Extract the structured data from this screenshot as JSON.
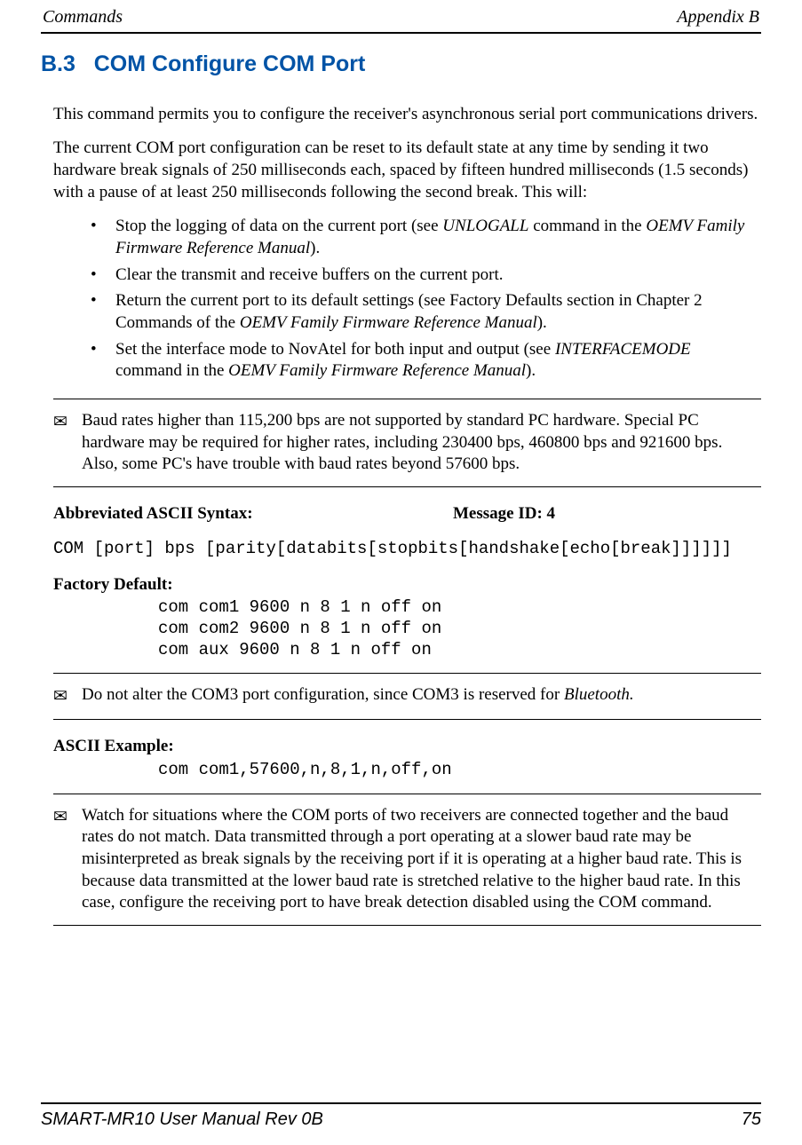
{
  "header": {
    "left": "Commands",
    "right": "Appendix B"
  },
  "section": {
    "number": "B.3",
    "title": "COM Configure COM Port"
  },
  "paragraphs": {
    "intro1": "This command permits you to configure the receiver's asynchronous serial port communications drivers.",
    "intro2": "The current COM port configuration can be reset to its default state at any time by sending it two hardware break signals of 250 milliseconds each, spaced by fifteen hundred milliseconds (1.5 seconds) with a pause of at least 250 milliseconds following the second break. This will:"
  },
  "bullets": {
    "b1a": "Stop the logging of data on the current port (see ",
    "b1b": "UNLOGALL",
    "b1c": " command in the ",
    "b1d": "OEMV Family Firmware Reference Manual",
    "b1e": ").",
    "b2": "Clear the transmit and receive buffers on the current port.",
    "b3a": "Return the current port to its default settings (see Factory Defaults section in Chapter 2 Commands of the ",
    "b3b": "OEMV Family Firmware Reference Manual",
    "b3c": ").",
    "b4a": "Set the interface mode to NovAtel for both input and output (see ",
    "b4b": "INTERFACEMODE",
    "b4c": " command in the ",
    "b4d": "OEMV Family Firmware Reference Manual",
    "b4e": ")."
  },
  "notes": {
    "n1": "Baud rates higher than 115,200 bps are not supported by standard PC hardware. Special PC hardware may be required for higher rates, including 230400 bps, 460800 bps and 921600 bps. Also, some PC's have trouble with baud rates beyond 57600 bps.",
    "n2a": "Do not alter the COM3 port configuration, since COM3 is reserved for ",
    "n2b": "Bluetooth.",
    "n3": "Watch for situations where the COM ports of two receivers are connected together and the baud rates do not match. Data transmitted through a port operating at a slower baud rate may be misinterpreted as break signals by the receiving port if it is operating at a higher baud rate. This is because data transmitted at the lower baud rate is stretched relative to the higher baud rate. In this case, configure the receiving port to have break detection disabled using the COM command."
  },
  "syntax": {
    "label": "Abbreviated ASCII Syntax:",
    "msgid": "Message ID: 4",
    "line": "COM [port] bps [parity[databits[stopbits[handshake[echo[break]]]]]]"
  },
  "factory": {
    "label": "Factory Default:",
    "l1": "com com1 9600 n 8 1 n off on",
    "l2": "com com2 9600 n 8 1 n off on",
    "l3": "com aux 9600 n 8 1 n off on"
  },
  "example": {
    "label": "ASCII Example:",
    "l1": "com com1,57600,n,8,1,n,off,on"
  },
  "footer": {
    "left": "SMART-MR10 User Manual Rev 0B",
    "page": "75"
  },
  "icons": {
    "envelope": "✉"
  }
}
